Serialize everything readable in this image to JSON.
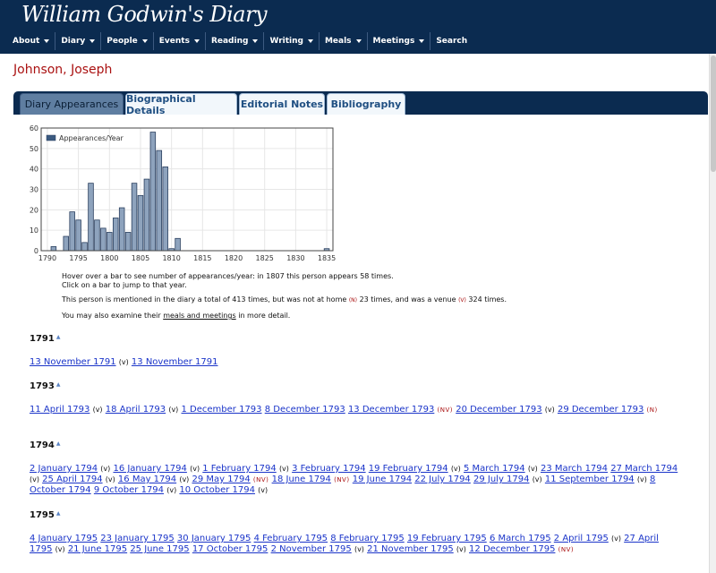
{
  "header": {
    "logo_text": "William Godwin's Diary",
    "nav": [
      "About",
      "Diary",
      "People",
      "Events",
      "Reading",
      "Writing",
      "Meals",
      "Meetings",
      "Search"
    ]
  },
  "page_title": "Johnson, Joseph",
  "tabs": [
    "Diary Appearances",
    "Biographical Details",
    "Editorial Notes",
    "Bibliography"
  ],
  "chart_data": {
    "type": "bar",
    "legend": "Appearances/Year",
    "x": [
      1791,
      1793,
      1794,
      1795,
      1796,
      1797,
      1798,
      1799,
      1800,
      1801,
      1802,
      1803,
      1804,
      1805,
      1806,
      1807,
      1808,
      1809,
      1810,
      1811,
      1835
    ],
    "values": [
      2,
      7,
      19,
      15,
      4,
      33,
      15,
      11,
      9,
      16,
      21,
      9,
      33,
      27,
      35,
      58,
      49,
      41,
      1,
      6,
      1
    ],
    "xticks": [
      1790,
      1795,
      1800,
      1805,
      1810,
      1815,
      1820,
      1825,
      1830,
      1835
    ],
    "yticks": [
      0,
      10,
      20,
      30,
      40,
      50,
      60
    ],
    "xlim": [
      1789,
      1836
    ],
    "ylim": [
      0,
      60
    ],
    "grid": true,
    "legend_position": "top-left"
  },
  "info": {
    "hover_text": "Hover over a bar to see number of appearances/year: in 1807 this person appears 58 times.",
    "click_text": "Click on a bar to jump to that year.",
    "mention_text_1": "This person is mentioned in the diary a total of 413 times, but was not at home",
    "badge_n": "(N)",
    "mention_text_2": "23 times, and was a venue",
    "badge_v": "(V)",
    "mention_text_3": "324 times.",
    "examine_text_1": "You may also examine their",
    "examine_link": "meals and meetings",
    "examine_text_2": "in more detail."
  },
  "years": [
    {
      "year": "1791",
      "entries": [
        {
          "date": "13 November 1791",
          "tag": "(v)"
        },
        {
          "date": "13 November 1791",
          "tag": ""
        }
      ]
    },
    {
      "year": "1793",
      "entries": [
        {
          "date": "11 April 1793",
          "tag": "(v)"
        },
        {
          "date": "18 April 1793",
          "tag": "(v)"
        },
        {
          "date": "1 December 1793",
          "tag": ""
        },
        {
          "date": "8 December 1793",
          "tag": ""
        },
        {
          "date": "13 December 1793",
          "tag": "(NV)"
        },
        {
          "date": "20 December 1793",
          "tag": "(v)"
        },
        {
          "date": "29 December 1793",
          "tag": "(N)"
        }
      ]
    },
    {
      "year": "1794",
      "entries": [
        {
          "date": "2 January 1794",
          "tag": "(v)"
        },
        {
          "date": "16 January 1794",
          "tag": "(v)"
        },
        {
          "date": "1 February 1794",
          "tag": "(v)"
        },
        {
          "date": "3 February 1794",
          "tag": ""
        },
        {
          "date": "19 February 1794",
          "tag": "(v)"
        },
        {
          "date": "5 March 1794",
          "tag": "(v)"
        },
        {
          "date": "23 March 1794",
          "tag": ""
        },
        {
          "date": "27 March 1794",
          "tag": "(v)"
        },
        {
          "date": "25 April 1794",
          "tag": "(v)"
        },
        {
          "date": "16 May 1794",
          "tag": "(v)"
        },
        {
          "date": "29 May 1794",
          "tag": "(NV)"
        },
        {
          "date": "18 June 1794",
          "tag": "(NV)"
        },
        {
          "date": "19 June 1794",
          "tag": ""
        },
        {
          "date": "22 July 1794",
          "tag": ""
        },
        {
          "date": "29 July 1794",
          "tag": "(v)"
        },
        {
          "date": "11 September 1794",
          "tag": "(v)"
        },
        {
          "date": "8 October 1794",
          "tag": ""
        },
        {
          "date": "9 October 1794",
          "tag": "(v)"
        },
        {
          "date": "10 October 1794",
          "tag": "(v)"
        }
      ]
    },
    {
      "year": "1795",
      "entries": [
        {
          "date": "4 January 1795",
          "tag": ""
        },
        {
          "date": "23 January 1795",
          "tag": ""
        },
        {
          "date": "30 January 1795",
          "tag": ""
        },
        {
          "date": "4 February 1795",
          "tag": ""
        },
        {
          "date": "8 February 1795",
          "tag": ""
        },
        {
          "date": "19 February 1795",
          "tag": ""
        },
        {
          "date": "6 March 1795",
          "tag": ""
        },
        {
          "date": "2 April 1795",
          "tag": "(v)"
        },
        {
          "date": "27 April 1795",
          "tag": "(v)"
        },
        {
          "date": "21 June 1795",
          "tag": ""
        },
        {
          "date": "25 June 1795",
          "tag": ""
        },
        {
          "date": "17 October 1795",
          "tag": ""
        },
        {
          "date": "2 November 1795",
          "tag": "(v)"
        },
        {
          "date": "21 November 1795",
          "tag": "(v)"
        },
        {
          "date": "12 December 1795",
          "tag": "(NV)"
        }
      ]
    }
  ],
  "colors": {
    "header_bg": "#0b2b50",
    "title_red": "#aa1111",
    "link_blue": "#1a34c9",
    "bar_fill": "#8ea3bd",
    "bar_stroke": "#2a3f5f"
  }
}
